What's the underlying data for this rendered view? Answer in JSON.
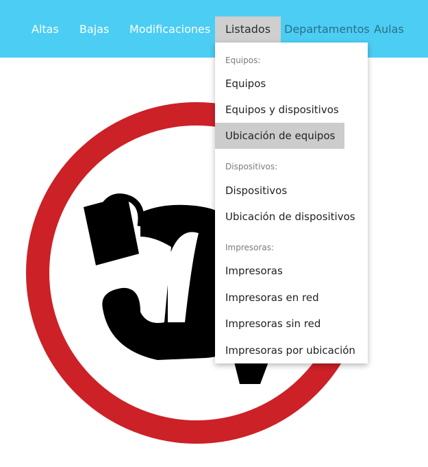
{
  "nav": {
    "altas": "Altas",
    "bajas": "Bajas",
    "modificaciones": "Modificaciones",
    "listados": "Listados",
    "departamentos": "Departamentos",
    "aulas": "Aulas"
  },
  "dropdown": {
    "header_equipos": "Equipos:",
    "equipos": "Equipos",
    "equipos_y_dispositivos": "Equipos y dispositivos",
    "ubicacion_de_equipos": "Ubicación de equipos",
    "header_dispositivos": "Dispositivos:",
    "dispositivos": "Dispositivos",
    "ubicacion_de_dispositivos": "Ubicación de dispositivos",
    "header_impresoras": "Impresoras:",
    "impresoras": "Impresoras",
    "impresoras_en_red": "Impresoras en red",
    "impresoras_sin_red": "Impresoras sin red",
    "impresoras_por_ubicacion": "Impresoras por ubicación"
  },
  "colors": {
    "navbar": "#4ccdf3",
    "sign_red": "#cc2127",
    "active_item": "#cfcfcf",
    "highlight_item": "#cccccc"
  }
}
